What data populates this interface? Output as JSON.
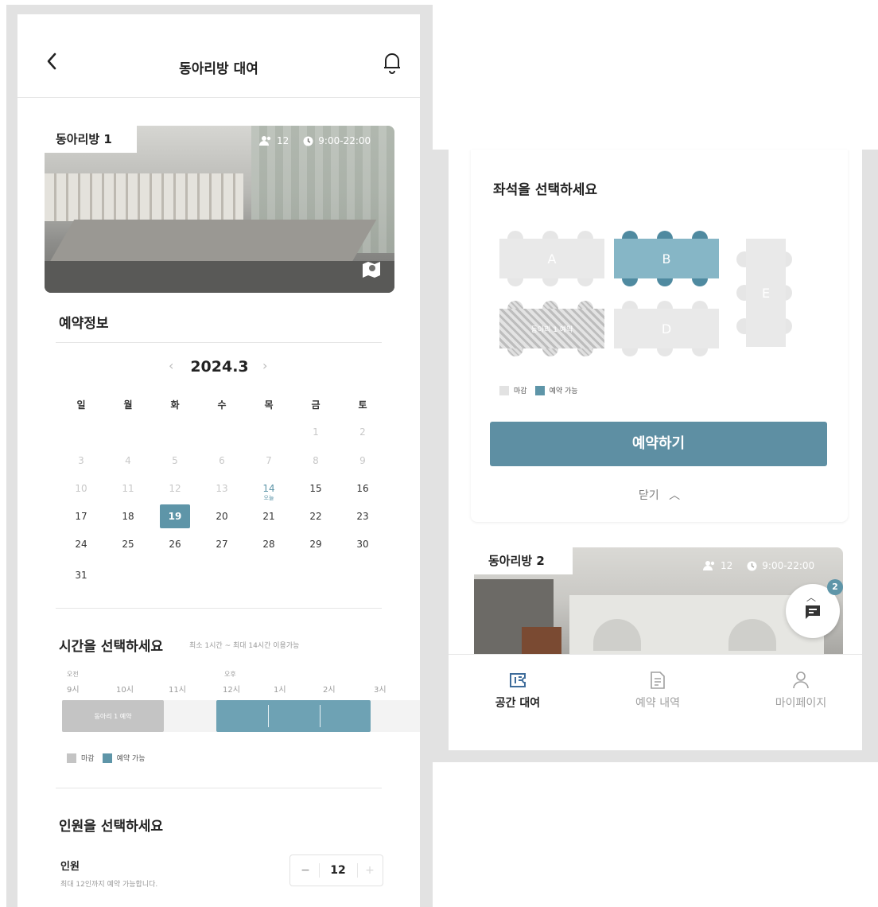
{
  "header": {
    "title": "동아리방 대여"
  },
  "room1": {
    "name": "동아리방 1",
    "capacity": "12",
    "hours": "9:00-22:00"
  },
  "reservation": {
    "title": "예약정보"
  },
  "calendar": {
    "month": "2024.3",
    "weekdays": [
      "일",
      "월",
      "화",
      "수",
      "목",
      "금",
      "토"
    ],
    "rows": [
      [
        "",
        "",
        "",
        "",
        "",
        "1",
        "2"
      ],
      [
        "3",
        "4",
        "5",
        "6",
        "7",
        "8",
        "9"
      ],
      [
        "10",
        "11",
        "12",
        "13",
        "14",
        "15",
        "16"
      ],
      [
        "17",
        "18",
        "19",
        "20",
        "21",
        "22",
        "23"
      ],
      [
        "24",
        "25",
        "26",
        "27",
        "28",
        "29",
        "30"
      ],
      [
        "31",
        "",
        "",
        "",
        "",
        "",
        ""
      ]
    ],
    "selected": "19",
    "today": "14",
    "today_sub": "오늘"
  },
  "time": {
    "title": "시간을 선택하세요",
    "hint": "최소 1시간 ~ 최대 14시간 이용가능",
    "am": "오전",
    "pm": "오후",
    "hours": [
      "9시",
      "10시",
      "11시",
      "12시",
      "1시",
      "2시",
      "3시"
    ],
    "booked_label": "동아리 1 예약"
  },
  "legend": {
    "closed": "마감",
    "available": "예약 가능"
  },
  "people": {
    "title": "인원을 선택하세요",
    "label": "인원",
    "note": "최대 12인까지 예약 가능합니다.",
    "value": "12",
    "minus": "−",
    "plus": "+"
  },
  "seat": {
    "title": "좌석을 선택하세요",
    "tables": {
      "a": "A",
      "b": "B",
      "d": "D",
      "e": "E"
    },
    "booked_label": "동아리 1 예약"
  },
  "reserve_button": "예약하기",
  "close_label": "닫기",
  "room2": {
    "name": "동아리방 2",
    "capacity": "12",
    "hours": "9:00-22:00"
  },
  "fab_badge": "2",
  "bottom_nav": [
    {
      "label": "공간 대여"
    },
    {
      "label": "예약 내역"
    },
    {
      "label": "마이페이지"
    }
  ],
  "colors": {
    "accent": "#5e95a8",
    "closed": "#c4c4c4",
    "bg_frame": "#e2e2e2"
  }
}
